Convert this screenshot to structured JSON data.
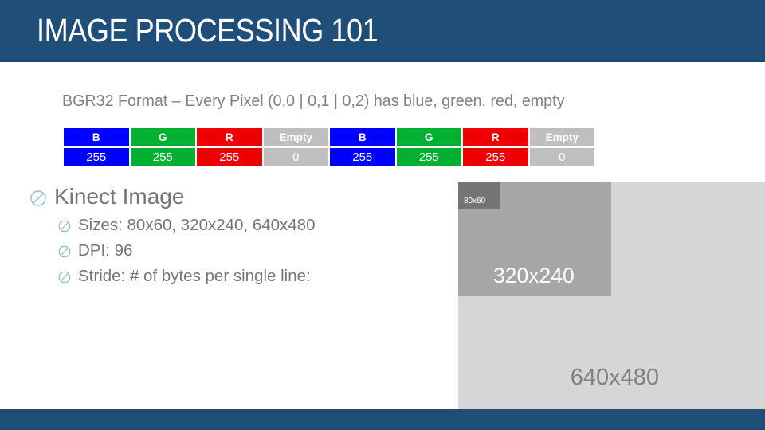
{
  "header": {
    "title": "IMAGE PROCESSING 101",
    "bar_color": "#1f4e79"
  },
  "subtitle": {
    "text": "BGR32 Format – Every Pixel (0,0 | 0,1 | 0,2) has blue, green, red, empty",
    "color": "#808080"
  },
  "pixel_table": {
    "colors": {
      "blue": "#0000ff",
      "green": "#00b030",
      "red": "#ee0000",
      "gray": "#bfbfbf"
    },
    "headers": [
      "B",
      "G",
      "R",
      "Empty",
      "B",
      "G",
      "R",
      "Empty"
    ],
    "values": [
      "255",
      "255",
      "255",
      "0",
      "255",
      "255",
      "255",
      "0"
    ],
    "cell_classes": [
      "cell-blue",
      "cell-green",
      "cell-red",
      "cell-gray",
      "cell-blue",
      "cell-green",
      "cell-red",
      "cell-gray"
    ]
  },
  "bullets": {
    "glyph_name": "prohibition-circle-bullet-icon",
    "glyph_color": "#8fbcd4",
    "items": [
      {
        "level": 1,
        "text": "Kinect Image"
      },
      {
        "level": 2,
        "text": "Sizes: 80x60, 320x240, 640x480"
      },
      {
        "level": 2,
        "text": "DPI: 96"
      },
      {
        "level": 2,
        "text": "Stride: # of bytes per single line:"
      }
    ]
  },
  "size_rects": {
    "small": {
      "label": "80x60",
      "fill": "#757575",
      "text_color": "#ffffff"
    },
    "medium": {
      "label": "320x240",
      "fill": "#a6a6a6",
      "text_color": "#ffffff"
    },
    "large": {
      "label": "640x480",
      "fill": "#d6d6d6",
      "text_color": "#808080"
    }
  },
  "footer": {
    "bar_color": "#1f4e79"
  }
}
